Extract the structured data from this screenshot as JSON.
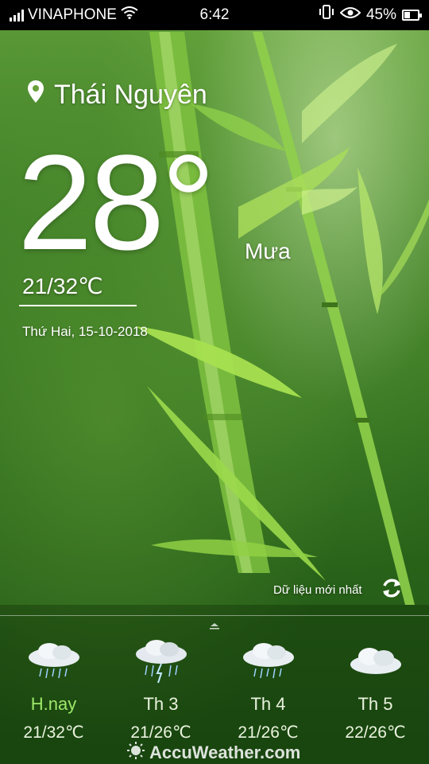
{
  "status_bar": {
    "carrier": "VINAPHONE",
    "time": "6:42",
    "battery_percent": "45%",
    "battery_level": 0.45,
    "icons": [
      "signal-icon",
      "wifi-icon",
      "vibrate-icon",
      "eye-icon",
      "battery-icon"
    ]
  },
  "weather": {
    "location": "Thái Nguyên",
    "temperature": "28°",
    "condition": "Mưa",
    "range": "21/32℃",
    "date": "Thứ Hai, 15-10-2018",
    "refresh_label": "Dữ liệu mới nhất"
  },
  "forecast": [
    {
      "day": "H.nay",
      "range": "21/32℃",
      "icon": "rain-cloud-icon"
    },
    {
      "day": "Th 3",
      "range": "21/26℃",
      "icon": "thunderstorm-cloud-icon"
    },
    {
      "day": "Th 4",
      "range": "21/26℃",
      "icon": "rain-cloud-icon"
    },
    {
      "day": "Th 5",
      "range": "22/26℃",
      "icon": "cloudy-icon"
    }
  ],
  "brand": "AccuWeather.com",
  "colors": {
    "today_accent": "#9ee86a",
    "background": "#3f7f27"
  }
}
